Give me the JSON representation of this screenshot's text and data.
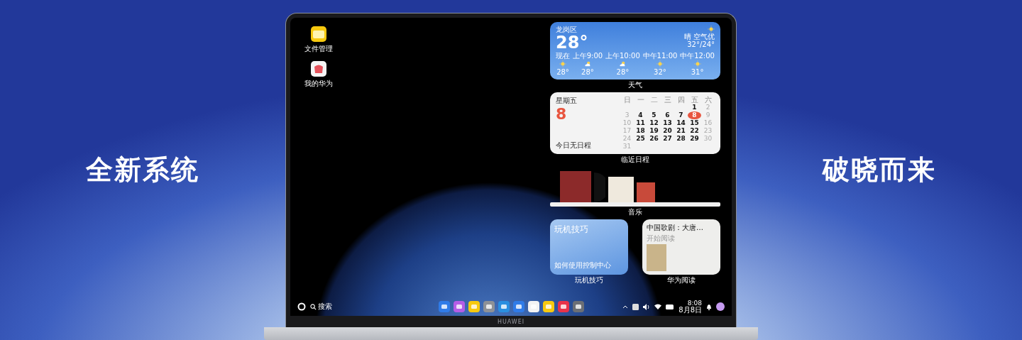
{
  "poster": {
    "left_slogan": "全新系统",
    "right_slogan": "破晓而来"
  },
  "laptop": {
    "brand": "HUAWEI"
  },
  "desktop_icons": [
    {
      "label": "文件管理",
      "kind": "files"
    },
    {
      "label": "我的华为",
      "kind": "myhuawei"
    }
  ],
  "weather_widget": {
    "location": "龙岗区",
    "temperature": "28°",
    "condition": "晴 空气优",
    "range": "32°/24°",
    "caption": "天气",
    "hours": [
      {
        "time": "现在",
        "temp": "28°",
        "kind": "sunny"
      },
      {
        "time": "上午9:00",
        "temp": "28°",
        "kind": "cloudy"
      },
      {
        "time": "上午10:00",
        "temp": "28°",
        "kind": "cloudy"
      },
      {
        "time": "中午11:00",
        "temp": "32°",
        "kind": "sunny"
      },
      {
        "time": "中午12:00",
        "temp": "31°",
        "kind": "sunny"
      }
    ]
  },
  "calendar_widget": {
    "weekday": "星期五",
    "day": "8",
    "note": "今日无日程",
    "caption": "临近日程",
    "headers": [
      "日",
      "一",
      "二",
      "三",
      "四",
      "五",
      "六"
    ],
    "weeks": [
      [
        {
          "day": "1",
          "selected": false
        },
        {
          "day": "2",
          "selected": false
        }
      ],
      [
        {
          "day": "3",
          "selected": false
        },
        {
          "day": "4",
          "selected": false
        },
        {
          "day": "5",
          "selected": false
        },
        {
          "day": "6",
          "selected": false
        },
        {
          "day": "7",
          "selected": false
        },
        {
          "day": "8",
          "selected": true
        },
        {
          "day": "9",
          "selected": false
        }
      ],
      [
        {
          "day": "10",
          "selected": false
        },
        {
          "day": "11",
          "selected": false
        },
        {
          "day": "12",
          "selected": false
        },
        {
          "day": "13",
          "selected": false
        },
        {
          "day": "14",
          "selected": false
        },
        {
          "day": "15",
          "selected": false
        },
        {
          "day": "16",
          "selected": false
        }
      ],
      [
        {
          "day": "17",
          "selected": false
        },
        {
          "day": "18",
          "selected": false
        },
        {
          "day": "19",
          "selected": false
        },
        {
          "day": "20",
          "selected": false
        },
        {
          "day": "21",
          "selected": false
        },
        {
          "day": "22",
          "selected": false
        },
        {
          "day": "23",
          "selected": false
        }
      ],
      [
        {
          "day": "24",
          "selected": false
        },
        {
          "day": "25",
          "selected": false
        },
        {
          "day": "26",
          "selected": false
        },
        {
          "day": "27",
          "selected": false
        },
        {
          "day": "28",
          "selected": false
        },
        {
          "day": "29",
          "selected": false
        },
        {
          "day": "30",
          "selected": false
        }
      ],
      [
        {
          "day": "31",
          "selected": false
        }
      ]
    ]
  },
  "music_widget": {
    "caption": "音乐"
  },
  "tips_widget": {
    "title": "玩机技巧",
    "subtitle": "如何使用控制中心",
    "caption": "玩机技巧"
  },
  "reading_widget": {
    "title": "中国歌剧：大唐…",
    "subtitle": "开始阅读",
    "caption": "华为阅读"
  },
  "taskbar": {
    "search": "搜索",
    "time": "8:08",
    "date": "8月8日"
  }
}
